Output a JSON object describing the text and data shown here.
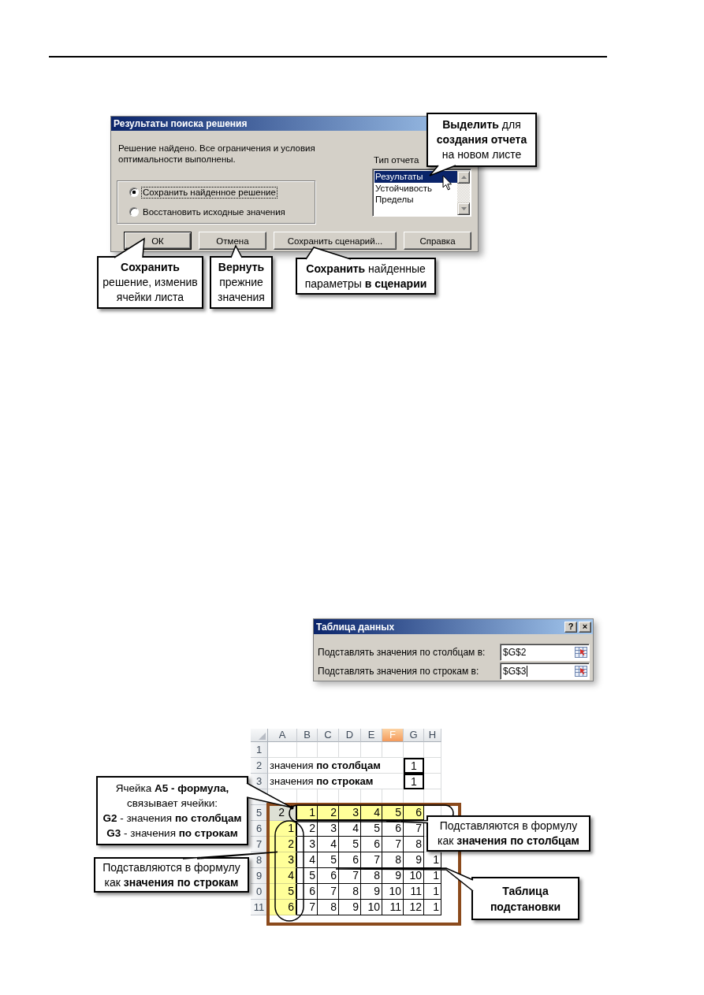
{
  "solver_dialog": {
    "title": "Результаты поиска решения",
    "message": [
      "Решение найдено. Все ограничения и условия",
      "оптимальности выполнены."
    ],
    "options": [
      {
        "label": "Сохранить найденное решение",
        "selected": true,
        "focused": true
      },
      {
        "label": "Восстановить исходные значения",
        "selected": false,
        "focused": false
      }
    ],
    "report_type": {
      "label": "Тип отчета",
      "items": [
        {
          "label": "Результаты",
          "selected": true
        },
        {
          "label": "Устойчивость",
          "selected": false
        },
        {
          "label": "Пределы",
          "selected": false
        }
      ]
    },
    "buttons": [
      {
        "label": "ОК",
        "default": true
      },
      {
        "label": "Отмена",
        "default": false
      },
      {
        "label": "Сохранить сценарий...",
        "default": false
      },
      {
        "label": "Справка",
        "default": false
      }
    ],
    "callouts": [
      {
        "lines": [
          "**Выделить** для",
          "**создания отчета**",
          "на новом листе"
        ]
      },
      {
        "lines": [
          "**Сохранить**",
          "решение, изменив",
          "ячейки листа"
        ]
      },
      {
        "lines": [
          "**Вернуть**",
          "прежние",
          "значения"
        ]
      },
      {
        "lines": [
          "**Сохранить** найденные",
          "параметры **в сценарии**"
        ]
      }
    ]
  },
  "data_table_dialog": {
    "title": "Таблица данных",
    "help_button": "?",
    "close_button": "×",
    "fields": [
      {
        "label": "Подставлять значения по столбцам в:",
        "value": "$G$2",
        "focused": false
      },
      {
        "label": "Подставлять значения по строкам в:",
        "value": "$G$3",
        "focused": true
      }
    ]
  },
  "spreadsheet": {
    "columns": [
      {
        "label": "A",
        "selected": false
      },
      {
        "label": "B",
        "selected": false
      },
      {
        "label": "C",
        "selected": false
      },
      {
        "label": "D",
        "selected": false
      },
      {
        "label": "E",
        "selected": false
      },
      {
        "label": "F",
        "selected": true
      },
      {
        "label": "G",
        "selected": false
      },
      {
        "label": "H",
        "selected": false
      }
    ],
    "rows": [
      {
        "header": "1",
        "cells": [
          null,
          null,
          null,
          null,
          null,
          null,
          null,
          null
        ]
      },
      {
        "header": "2",
        "cells": [
          {
            "kind": "label",
            "text": "значения **по столбцам**"
          },
          null,
          null,
          null,
          null,
          null,
          {
            "kind": "input",
            "text": "1"
          },
          null
        ]
      },
      {
        "header": "3",
        "cells": [
          {
            "kind": "label",
            "text": "значения **по строкам**"
          },
          null,
          null,
          null,
          null,
          null,
          {
            "kind": "input",
            "text": "1"
          },
          null
        ]
      },
      {
        "cells": [
          null,
          null,
          null,
          null,
          null,
          null,
          null,
          null
        ]
      },
      {
        "header": "5",
        "cells": [
          {
            "kind": "formula",
            "text": "2"
          },
          {
            "kind": "column_input",
            "text": "1"
          },
          {
            "kind": "column_input",
            "text": "2"
          },
          {
            "kind": "column_input",
            "text": "3"
          },
          {
            "kind": "column_input",
            "text": "4"
          },
          {
            "kind": "column_input",
            "text": "5"
          },
          {
            "kind": "column_input",
            "text": "6"
          },
          null
        ]
      },
      {
        "header": "6",
        "cells": [
          {
            "kind": "row_input",
            "text": "1"
          },
          {
            "kind": "result",
            "text": "2"
          },
          {
            "kind": "result",
            "text": "3"
          },
          {
            "kind": "result",
            "text": "4"
          },
          {
            "kind": "result",
            "text": "5"
          },
          {
            "kind": "result",
            "text": "6"
          },
          {
            "kind": "result",
            "text": "7"
          },
          null
        ]
      },
      {
        "header": "7",
        "cells": [
          {
            "kind": "row_input",
            "text": "2"
          },
          {
            "kind": "result",
            "text": "3"
          },
          {
            "kind": "result",
            "text": "4"
          },
          {
            "kind": "result",
            "text": "5"
          },
          {
            "kind": "result",
            "text": "6"
          },
          {
            "kind": "result",
            "text": "7"
          },
          {
            "kind": "result",
            "text": "8"
          },
          null
        ]
      },
      {
        "header": "8",
        "cells": [
          {
            "kind": "row_input",
            "text": "3"
          },
          {
            "kind": "result",
            "text": "4"
          },
          {
            "kind": "result",
            "text": "5"
          },
          {
            "kind": "result",
            "text": "6"
          },
          {
            "kind": "result",
            "text": "7"
          },
          {
            "kind": "result",
            "text": "8"
          },
          {
            "kind": "result",
            "text": "9"
          },
          {
            "kind": "result",
            "text": "1"
          }
        ]
      },
      {
        "header": "9",
        "cells": [
          {
            "kind": "row_input",
            "text": "4"
          },
          {
            "kind": "result",
            "text": "5"
          },
          {
            "kind": "result",
            "text": "6"
          },
          {
            "kind": "result",
            "text": "7"
          },
          {
            "kind": "result",
            "text": "8"
          },
          {
            "kind": "result",
            "text": "9"
          },
          {
            "kind": "result",
            "text": "10"
          },
          {
            "kind": "result",
            "text": "1"
          }
        ]
      },
      {
        "header": "0",
        "cells": [
          {
            "kind": "row_input",
            "text": "5"
          },
          {
            "kind": "result",
            "text": "6"
          },
          {
            "kind": "result",
            "text": "7"
          },
          {
            "kind": "result",
            "text": "8"
          },
          {
            "kind": "result",
            "text": "9"
          },
          {
            "kind": "result",
            "text": "10"
          },
          {
            "kind": "result",
            "text": "11"
          },
          {
            "kind": "result",
            "text": "1"
          }
        ]
      },
      {
        "header": "11",
        "cells": [
          {
            "kind": "row_input",
            "text": "6"
          },
          {
            "kind": "result",
            "text": "7"
          },
          {
            "kind": "result",
            "text": "8"
          },
          {
            "kind": "result",
            "text": "9"
          },
          {
            "kind": "result",
            "text": "10"
          },
          {
            "kind": "result",
            "text": "11"
          },
          {
            "kind": "result",
            "text": "12"
          },
          {
            "kind": "result",
            "text": "1"
          }
        ]
      }
    ],
    "callouts": [
      {
        "lines": [
          "Ячейка **A5 - формула,**",
          "связывает ячейки:",
          "**G2** - значения **по столбцам**",
          "**G3** - значения **по строкам**"
        ],
        "bold": false
      },
      {
        "lines": [
          "Подставляются в формулу",
          "как **значения по строкам**"
        ],
        "bold": false
      },
      {
        "lines": [
          "Подставляются в формулу",
          "как **значения по столбцам**"
        ],
        "bold": false
      },
      {
        "lines": [
          "Таблица",
          "подстановки"
        ],
        "bold": true
      }
    ]
  }
}
